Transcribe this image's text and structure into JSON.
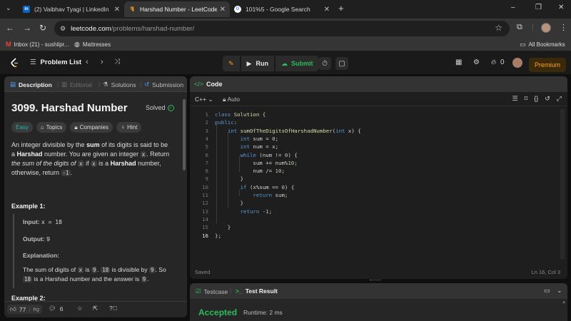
{
  "browser": {
    "tabs": [
      {
        "favicon": "linkedin-icon",
        "title": "(2) Vaibhav Tyagi | LinkedIn",
        "color": "#0a66c2"
      },
      {
        "favicon": "leetcode-icon",
        "title": "Harshad Number - LeetCode",
        "color": "#ffa116"
      },
      {
        "favicon": "google-icon",
        "title": "101%5 - Google Search",
        "color": "#ffffff"
      }
    ],
    "new_tab": "+",
    "window_controls": [
      "–",
      "❐",
      "✕"
    ],
    "address": {
      "host": "leetcode.com",
      "path": "/problems/harshad-number/"
    },
    "bookmarks": [
      {
        "icon": "gmail-icon",
        "label": "Inbox (21) - sushilpr..."
      },
      {
        "icon": "globe-icon",
        "label": "Mattresses"
      }
    ],
    "all_bookmarks": "All Bookmarks"
  },
  "lc_nav": {
    "problem_list": "Problem List",
    "run": "Run",
    "submit": "Submit",
    "streak_count": "0",
    "premium": "Premium",
    "accent": "#ffa116"
  },
  "left_tabs": {
    "description": "Description",
    "editorial": "Editorial",
    "solutions": "Solutions",
    "submissions": "Submission"
  },
  "problem": {
    "title": "3099. Harshad Number",
    "status": "Solved",
    "tags": {
      "difficulty": "Easy",
      "topics": "Topics",
      "companies": "Companies",
      "hint": "Hint"
    },
    "desc": {
      "t1": "An integer divisible by the ",
      "b1": "sum",
      "t2": " of its digits is said to be a ",
      "b2": "Harshad",
      "t3": " number. You are given an integer ",
      "c1": "x",
      "t4": ". Return ",
      "i1": "the sum of the digits of",
      "c2": "x",
      "t5": " if ",
      "c3": "x",
      "t6": " is a ",
      "b3": "Harshad",
      "t7": " number, otherwise, return ",
      "c4": "-1",
      "t8": "."
    },
    "example1": {
      "header": "Example 1:",
      "input_label": "Input:",
      "input": "x = 18",
      "output_label": "Output:",
      "output": "9",
      "expl_label": "Explanation:",
      "e1": "The sum of digits of ",
      "ec1": "x",
      "e2": " is ",
      "ec2": "9",
      "e3": ". ",
      "ec3": "18",
      "e4": " is divisible by ",
      "ec4": "9",
      "e5": ". So ",
      "ec5": "18",
      "e6": " is a Harshad number and the answer is ",
      "ec6": "9",
      "e7": "."
    },
    "example2_header": "Example 2:"
  },
  "footer": {
    "likes": "77",
    "comments": "6"
  },
  "code_panel": {
    "title": "Code",
    "language": "C++",
    "auto": "Auto",
    "status": "Saved",
    "cursor": "Ln 16, Col 3",
    "lines": [
      "class Solution {",
      "public:",
      "    int sumOfTheDigitsOfHarshadNumber(int x) {",
      "        int sum = 0;",
      "        int num = x;",
      "        while (num != 0) {",
      "            sum += num%10;",
      "            num /= 10;",
      "        }",
      "        if (x%sum == 0) {",
      "            return sum;",
      "        }",
      "        return -1;",
      "",
      "    }",
      "};"
    ]
  },
  "result_panel": {
    "testcase": "Testcase",
    "test_result": "Test Result",
    "verdict": "Accepted",
    "runtime": "Runtime: 2 ms"
  }
}
